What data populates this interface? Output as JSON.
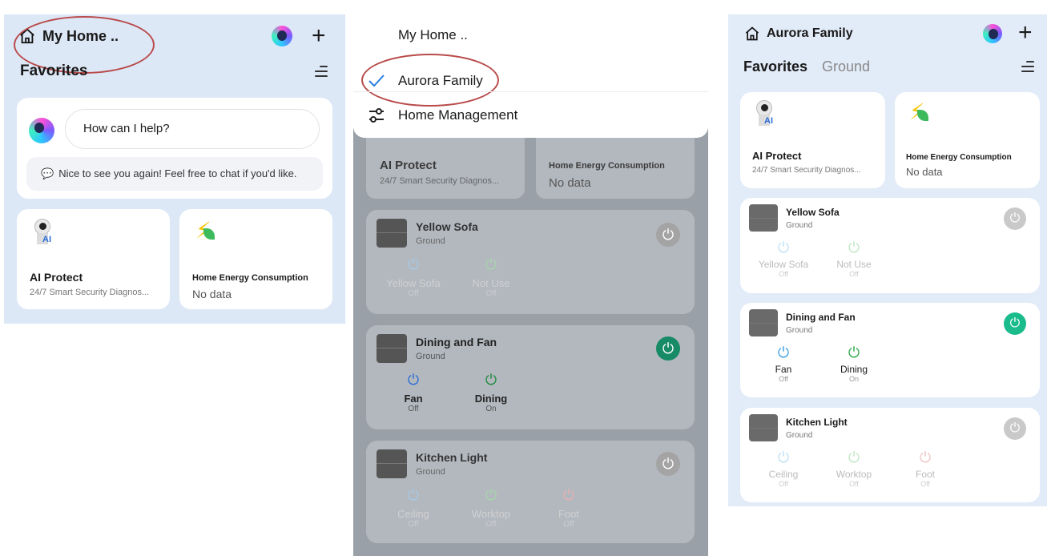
{
  "panel1": {
    "home_name": "My Home ..",
    "section": "Favorites",
    "assistant_prompt": "How can I help?",
    "assistant_greeting": "Nice to see you again! Feel free to chat if you'd like.",
    "card_ai": {
      "title": "AI Protect",
      "subtitle": "24/7 Smart Security Diagnos..."
    },
    "card_energy": {
      "title": "Home Energy Consumption",
      "value": "No data"
    }
  },
  "panel2": {
    "menu_items": [
      {
        "label": "My Home .."
      },
      {
        "label": "Aurora Family"
      },
      {
        "label": "Home Management"
      }
    ],
    "card_ai": {
      "title": "AI Protect",
      "subtitle": "24/7 Smart Security Diagnos..."
    },
    "card_energy": {
      "title": "Home Energy Consumption",
      "value": "No data"
    },
    "devices": [
      {
        "name": "Yellow Sofa",
        "room": "Ground",
        "switches": [
          {
            "label": "Yellow Sofa",
            "state": "Off"
          },
          {
            "label": "Not Use",
            "state": "Off"
          }
        ]
      },
      {
        "name": "Dining and Fan",
        "room": "Ground",
        "switches": [
          {
            "label": "Fan",
            "state": "Off"
          },
          {
            "label": "Dining",
            "state": "On"
          }
        ]
      },
      {
        "name": "Kitchen Light",
        "room": "Ground",
        "switches": [
          {
            "label": "Ceiling",
            "state": "Off"
          },
          {
            "label": "Worktop",
            "state": "Off"
          },
          {
            "label": "Foot",
            "state": "Off"
          }
        ]
      }
    ]
  },
  "panel3": {
    "home_name": "Aurora Family",
    "tabs": [
      {
        "label": "Favorites"
      },
      {
        "label": "Ground"
      }
    ],
    "card_ai": {
      "title": "AI Protect",
      "subtitle": "24/7 Smart Security Diagnos..."
    },
    "card_energy": {
      "title": "Home Energy Consumption",
      "value": "No data"
    },
    "devices": [
      {
        "name": "Yellow Sofa",
        "room": "Ground",
        "switches": [
          {
            "label": "Yellow Sofa",
            "state": "Off"
          },
          {
            "label": "Not Use",
            "state": "Off"
          }
        ]
      },
      {
        "name": "Dining and Fan",
        "room": "Ground",
        "switches": [
          {
            "label": "Fan",
            "state": "Off"
          },
          {
            "label": "Dining",
            "state": "On"
          }
        ]
      },
      {
        "name": "Kitchen Light",
        "room": "Ground",
        "switches": [
          {
            "label": "Ceiling",
            "state": "Off"
          },
          {
            "label": "Worktop",
            "state": "Off"
          },
          {
            "label": "Foot",
            "state": "Off"
          }
        ]
      }
    ]
  },
  "colors": {
    "accent_green": "#1abc8c",
    "check_blue": "#2a7de1",
    "annotation_red": "#b94a4a"
  }
}
